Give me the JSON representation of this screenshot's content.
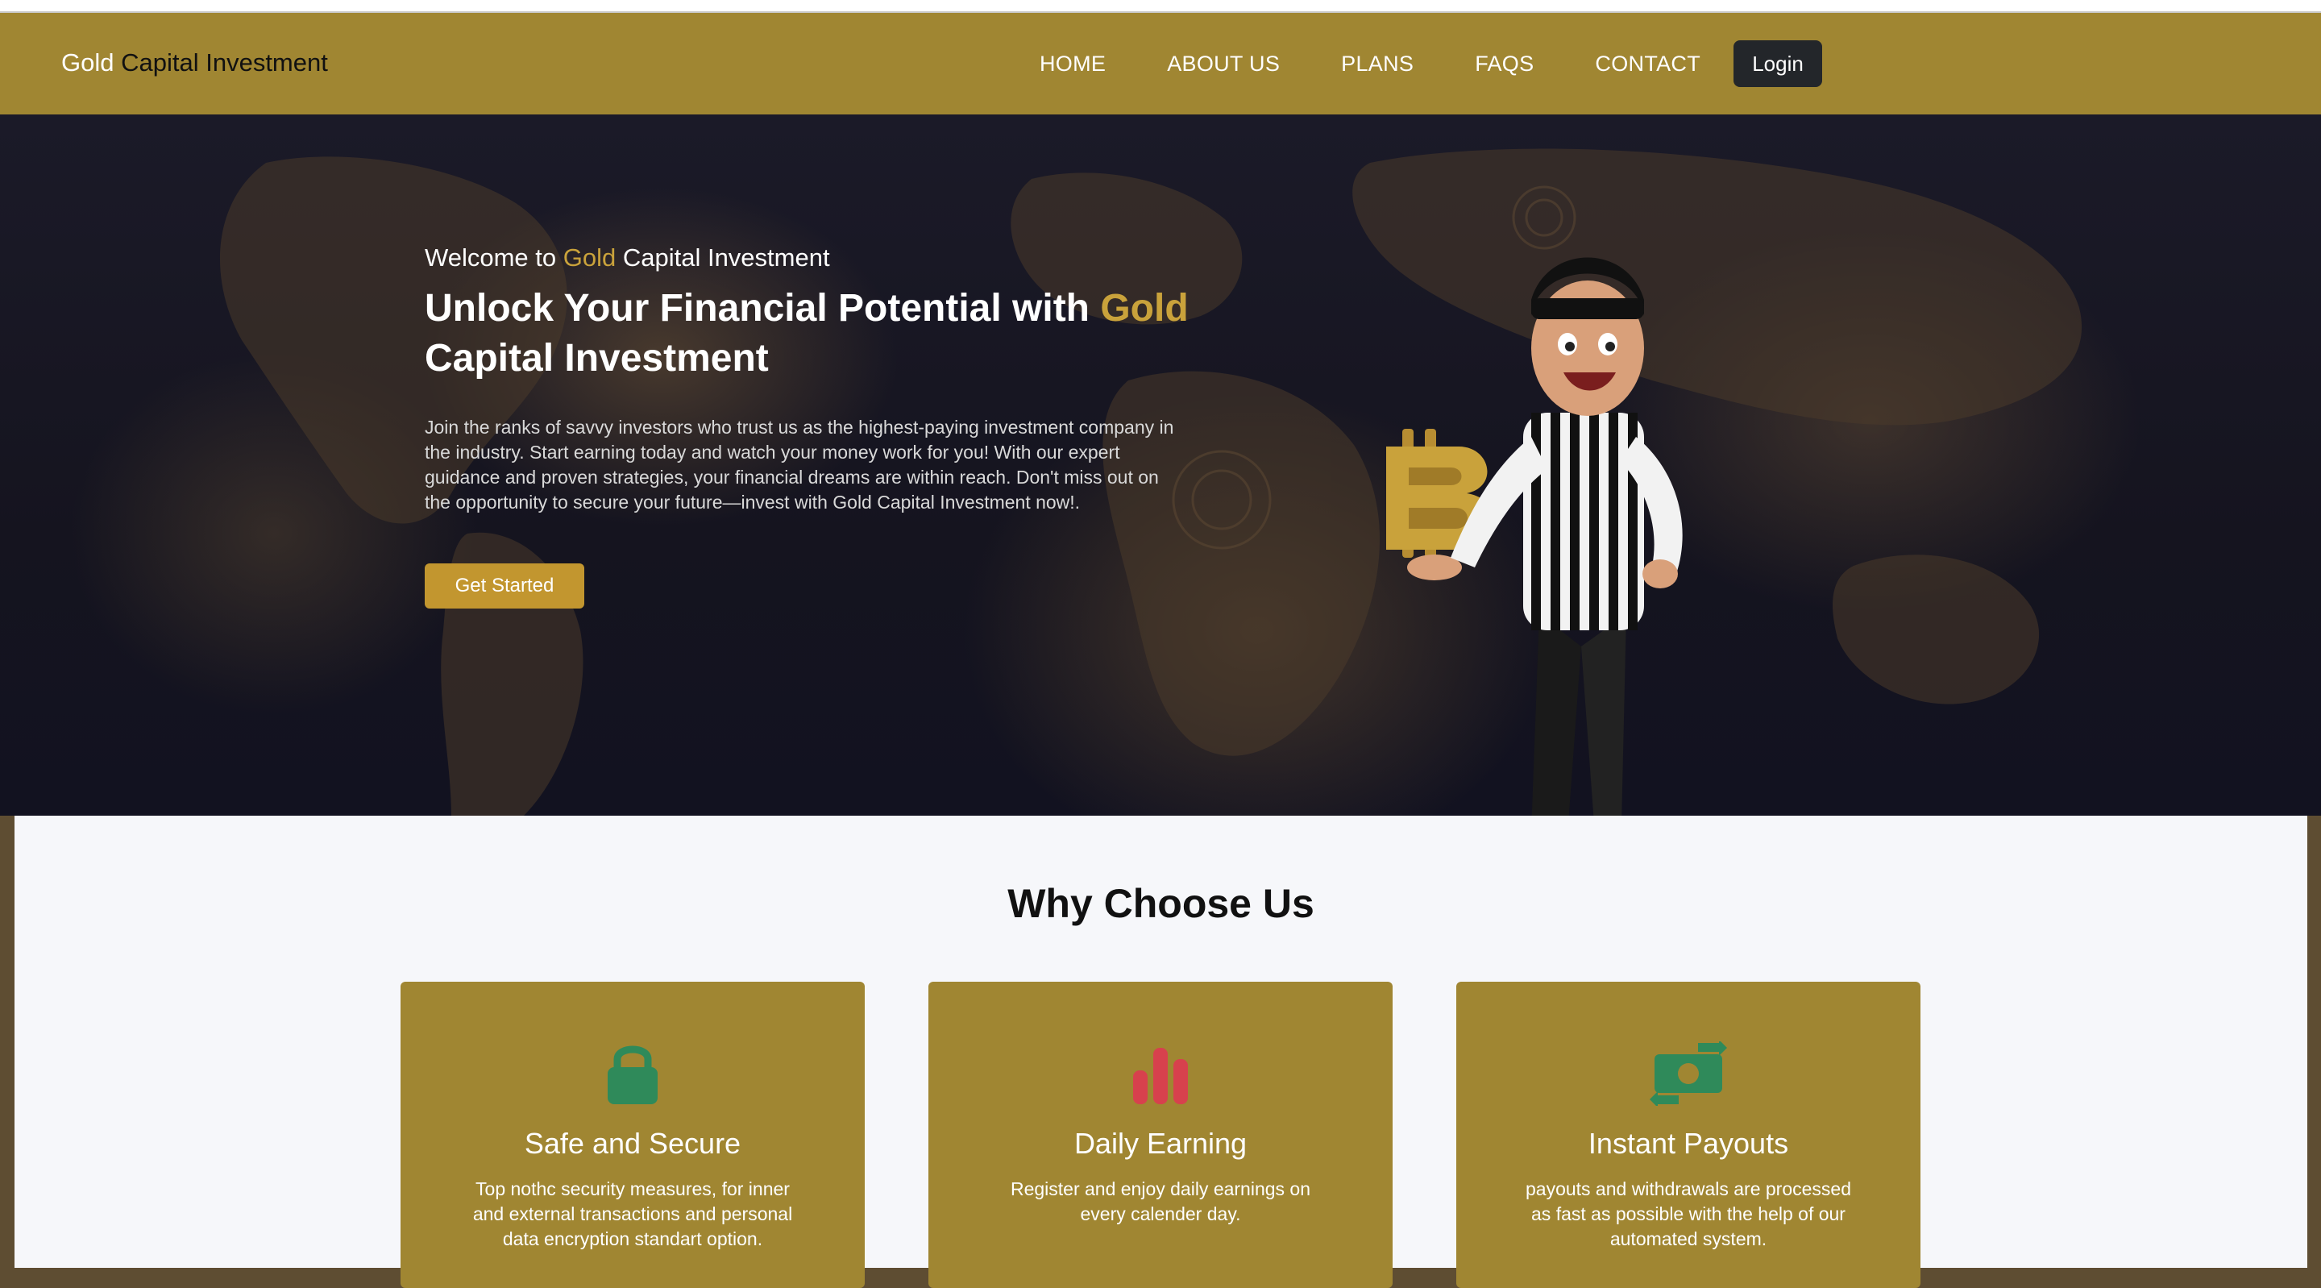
{
  "brand": {
    "part1": "Gold",
    "part2": "Capital Investment"
  },
  "nav": {
    "items": [
      {
        "label": "HOME"
      },
      {
        "label": "ABOUT US"
      },
      {
        "label": "PLANS"
      },
      {
        "label": "FAQS"
      },
      {
        "label": "CONTACT"
      }
    ],
    "login_label": "Login"
  },
  "hero": {
    "welcome_prefix": "Welcome to",
    "welcome_highlight": "Gold",
    "welcome_suffix": "Capital Investment",
    "title_prefix": "Unlock Your Financial Potential with",
    "title_highlight": "Gold",
    "title_suffix": "Capital Investment",
    "description": "Join the ranks of savvy investors who trust us as the highest-paying investment company in the industry. Start earning today and watch your money work for you! With our expert guidance and proven strategies, your financial dreams are within reach. Don't miss out on the opportunity to secure your future—invest with Gold Capital Investment now!.",
    "cta_label": "Get Started"
  },
  "why": {
    "title": "Why Choose Us",
    "cards": [
      {
        "icon": "lock-icon",
        "title": "Safe and Secure",
        "description": "Top nothc security measures, for inner and external transactions and personal data encryption standart option."
      },
      {
        "icon": "bar-chart-icon",
        "title": "Daily Earning",
        "description": "Register and enjoy daily earnings on every calender day."
      },
      {
        "icon": "money-exchange-icon",
        "title": "Instant Payouts",
        "description": "payouts and withdrawals are processed as fast as possible with the help of our automated system."
      }
    ]
  },
  "colors": {
    "brand_gold": "#a08632",
    "accent_gold": "#c9a23b",
    "button_gold": "#c2962f",
    "login_dark": "#23262a",
    "icon_green": "#2f8a5a",
    "icon_red": "#d7414d"
  }
}
